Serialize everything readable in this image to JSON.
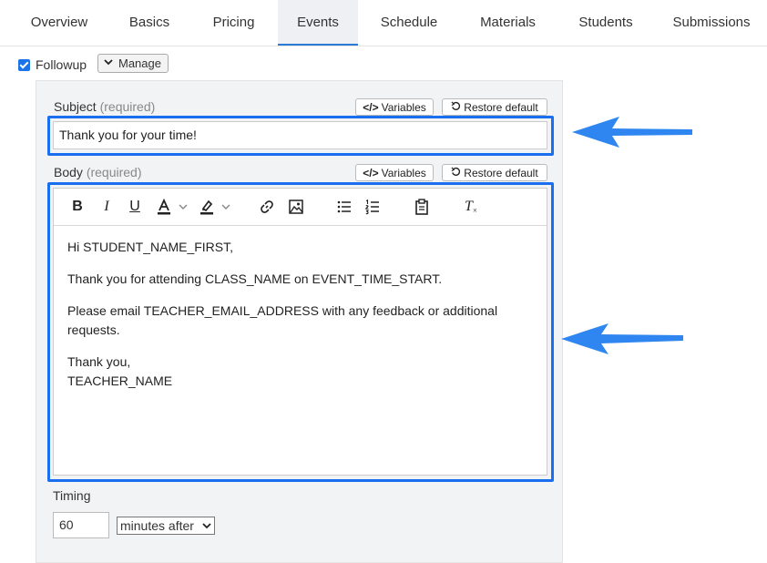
{
  "tabs": [
    {
      "label": "Overview"
    },
    {
      "label": "Basics"
    },
    {
      "label": "Pricing"
    },
    {
      "label": "Events",
      "active": true
    },
    {
      "label": "Schedule"
    },
    {
      "label": "Materials"
    },
    {
      "label": "Students"
    },
    {
      "label": "Submissions"
    }
  ],
  "followup": {
    "label": "Followup",
    "checked": true,
    "manage_label": "Manage"
  },
  "subject": {
    "label": "Subject",
    "required": "(required)",
    "variables_label": "Variables",
    "restore_label": "Restore default",
    "value": "Thank you for your time!"
  },
  "body": {
    "label": "Body",
    "required": "(required)",
    "variables_label": "Variables",
    "restore_label": "Restore default",
    "lines": {
      "greeting": "Hi STUDENT_NAME_FIRST,",
      "line1": "Thank you for attending CLASS_NAME on EVENT_TIME_START.",
      "line2a": "Please email TEACHER_EMAIL_ADDRESS with any feedback or additional",
      "line2b": "requests.",
      "signoff": "Thank you,",
      "signature": "TEACHER_NAME"
    }
  },
  "toolbar": {
    "bold": "B",
    "italic": "I",
    "underline": "U",
    "clear_format": "T"
  },
  "timing": {
    "label": "Timing",
    "value": "60",
    "unit": "minutes after"
  },
  "colors": {
    "accent": "#1a73e8",
    "highlight_border": "#1a6ef0",
    "arrow": "#2f86f0"
  }
}
